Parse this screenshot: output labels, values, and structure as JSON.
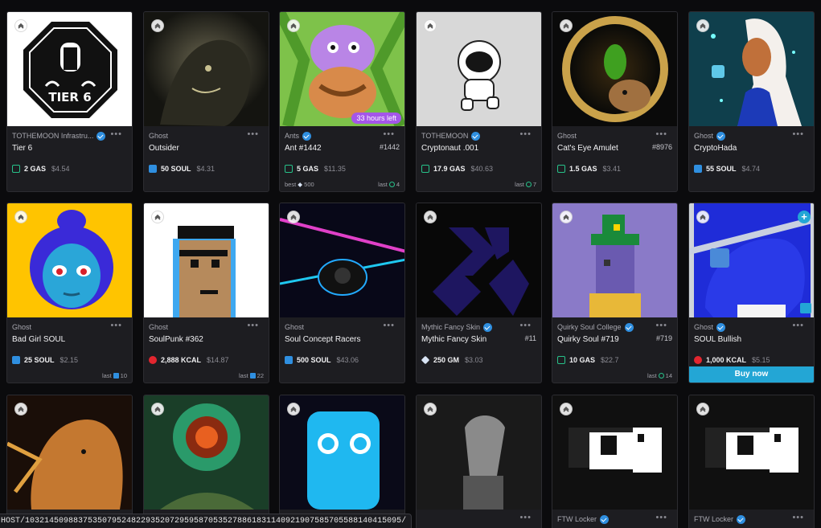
{
  "status_url": "HOST/103214509883753507952482293520729595870535278861831140921907585705588140415095/",
  "buy_label": "Buy now",
  "last_label": "last",
  "best_label": "best",
  "cards": [
    {
      "collection": "TOTHEMOON Infrastru...",
      "verified": true,
      "name": "Tier 6",
      "number": "",
      "price": "2 GAS",
      "usd": "$4.54",
      "token": "gas",
      "art": "tier6",
      "timer": "",
      "best": "",
      "last": ""
    },
    {
      "collection": "Ghost",
      "verified": false,
      "name": "Outsider",
      "number": "",
      "price": "50 SOUL",
      "usd": "$4.31",
      "token": "soul",
      "art": "outsider",
      "timer": "",
      "best": "",
      "last": ""
    },
    {
      "collection": "Ants",
      "verified": true,
      "name": "Ant #1442",
      "number": "#1442",
      "price": "5 GAS",
      "usd": "$11.35",
      "token": "gas",
      "art": "ant",
      "timer": "33 hours left",
      "best": "500",
      "last": "4"
    },
    {
      "collection": "TOTHEMOON",
      "verified": true,
      "name": "Cryptonaut .001",
      "number": "",
      "price": "17.9 GAS",
      "usd": "$40.63",
      "token": "gas",
      "art": "astronaut",
      "timer": "",
      "best": "",
      "last": "7"
    },
    {
      "collection": "Ghost",
      "verified": false,
      "name": "Cat's Eye Amulet",
      "number": "#8976",
      "price": "1.5 GAS",
      "usd": "$3.41",
      "token": "gas",
      "art": "amulet",
      "timer": "",
      "best": "",
      "last": ""
    },
    {
      "collection": "Ghost",
      "verified": true,
      "name": "CryptoHada",
      "number": "",
      "price": "55 SOUL",
      "usd": "$4.74",
      "token": "soul",
      "art": "hada",
      "timer": "",
      "best": "",
      "last": ""
    },
    {
      "collection": "Ghost",
      "verified": false,
      "name": "Bad Girl SOUL",
      "number": "",
      "price": "25 SOUL",
      "usd": "$2.15",
      "token": "soul",
      "art": "badgirl",
      "timer": "",
      "best": "",
      "last": "10",
      "last_token": "soul"
    },
    {
      "collection": "Ghost",
      "verified": false,
      "name": "SoulPunk #362",
      "number": "",
      "price": "2,888 KCAL",
      "usd": "$14.87",
      "token": "kcal",
      "art": "punk",
      "timer": "",
      "best": "",
      "last": "22",
      "last_token": "soul"
    },
    {
      "collection": "Ghost",
      "verified": false,
      "name": "Soul Concept Racers",
      "number": "",
      "price": "500 SOUL",
      "usd": "$43.06",
      "token": "soul",
      "art": "racers",
      "timer": "",
      "best": "",
      "last": ""
    },
    {
      "collection": "Mythic Fancy Skin",
      "verified": true,
      "name": "Mythic Fancy Skin",
      "number": "#11",
      "price": "250 GM",
      "usd": "$3.03",
      "token": "gm",
      "art": "mythic",
      "timer": "",
      "best": "",
      "last": ""
    },
    {
      "collection": "Quirky Soul College",
      "verified": true,
      "name": "Quirky Soul #719",
      "number": "#719",
      "price": "10 GAS",
      "usd": "$22.7",
      "token": "gas",
      "art": "quirky",
      "timer": "",
      "best": "",
      "last": "14"
    },
    {
      "collection": "Ghost",
      "verified": true,
      "name": "SOUL Bullish",
      "number": "",
      "price": "1,000 KCAL",
      "usd": "$5.15",
      "token": "kcal",
      "art": "bull",
      "timer": "",
      "best": "",
      "last": "",
      "buy": true
    },
    {
      "collection": "",
      "verified": false,
      "name": "",
      "number": "",
      "art": "portrait"
    },
    {
      "collection": "",
      "verified": false,
      "name": "",
      "number": "",
      "art": "forest"
    },
    {
      "collection": "",
      "verified": false,
      "name": "",
      "number": "",
      "art": "ghostblue"
    },
    {
      "collection": "",
      "verified": false,
      "name": "",
      "number": "",
      "art": "sculpture"
    },
    {
      "collection": "FTW Locker",
      "verified": true,
      "name": "",
      "number": "",
      "art": "locker"
    },
    {
      "collection": "FTW Locker",
      "verified": true,
      "name": "",
      "number": "",
      "art": "locker"
    }
  ]
}
